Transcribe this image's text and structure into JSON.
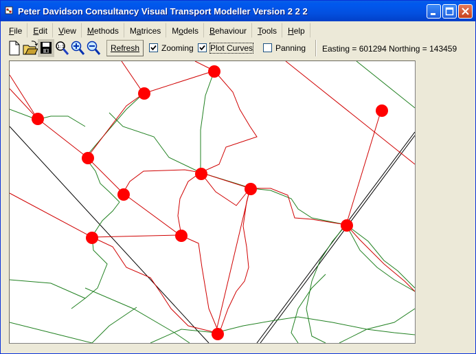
{
  "window": {
    "title": "Peter Davidson  Consultancy Visual Transport Modeller Version 2 2 2",
    "icon": "app-icon",
    "controls": [
      "minimize-icon",
      "maximize-icon",
      "close-icon"
    ]
  },
  "menu": {
    "items": [
      {
        "id": "file",
        "accel": "F",
        "rest": "ile"
      },
      {
        "id": "edit",
        "accel": "E",
        "rest": "dit"
      },
      {
        "id": "view",
        "accel": "V",
        "rest": "iew"
      },
      {
        "id": "methods",
        "accel": "M",
        "rest": "ethods"
      },
      {
        "id": "matrices",
        "pre": "M",
        "accel": "a",
        "rest": "trices"
      },
      {
        "id": "models",
        "pre": "M",
        "accel": "o",
        "rest": "dels"
      },
      {
        "id": "behaviour",
        "accel": "B",
        "rest": "ehaviour"
      },
      {
        "id": "tools",
        "accel": "T",
        "rest": "ools"
      },
      {
        "id": "help",
        "accel": "H",
        "rest": "elp"
      }
    ]
  },
  "toolbar": {
    "icons": [
      "new-file-icon",
      "open-folder-icon",
      "save-disk-icon",
      "zoom-extents-icon",
      "zoom-in-icon",
      "zoom-out-icon"
    ],
    "refresh_label": "Refresh",
    "zooming": {
      "label": "Zooming",
      "checked": true
    },
    "plot_curves": {
      "label": "Plot Curves",
      "checked": true
    },
    "panning": {
      "label": "Panning",
      "checked": false
    }
  },
  "status": {
    "coords": "Easting = 601294  Northing = 143459"
  },
  "map": {
    "colors": {
      "road_red": "#D00000",
      "road_green": "#208020",
      "rail_black": "#000000",
      "node": "#FF0000"
    },
    "node_count": 13
  }
}
